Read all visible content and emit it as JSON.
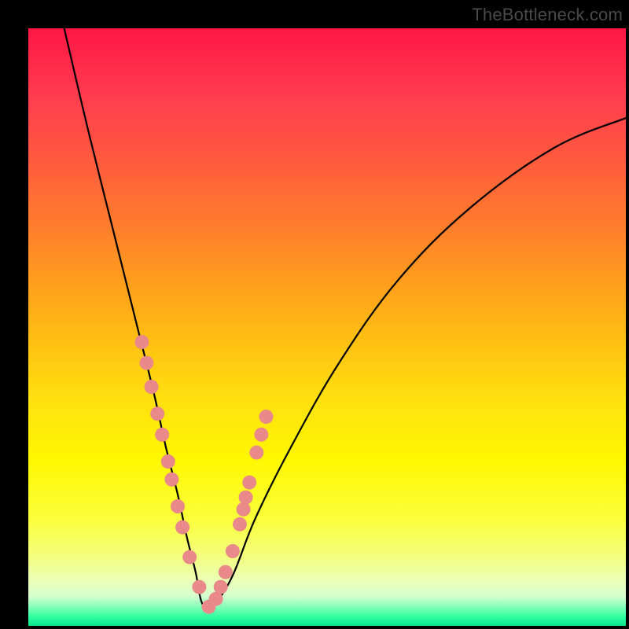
{
  "watermark": "TheBottleneck.com",
  "colors": {
    "dot": "#e98989",
    "curve": "#000000",
    "frame": "#000000"
  },
  "chart_data": {
    "type": "line",
    "title": "",
    "xlabel": "",
    "ylabel": "",
    "x_range": [
      0,
      100
    ],
    "y_range": [
      0,
      100
    ],
    "note": "Scales approximate; no axis labels visible in image.",
    "series": [
      {
        "name": "bottleneck-curve",
        "x": [
          6,
          10,
          14,
          18,
          21,
          23,
          25,
          26.5,
          28,
          29,
          30.5,
          34,
          38,
          44,
          52,
          62,
          74,
          88,
          100
        ],
        "y": [
          100,
          83,
          67,
          51,
          39,
          30,
          22,
          15,
          9,
          4,
          3,
          8,
          18,
          30,
          44,
          58,
          70,
          80,
          85
        ]
      }
    ],
    "markers": {
      "name": "highlighted-points",
      "x": [
        19.0,
        19.8,
        20.6,
        21.6,
        22.4,
        23.4,
        24.0,
        25.0,
        25.8,
        27.0,
        28.6,
        30.2,
        31.4,
        32.2,
        33.0,
        34.2,
        35.4,
        36.0,
        36.4,
        37.0,
        38.2,
        39.0,
        39.8
      ],
      "y": [
        47.5,
        44.0,
        40.0,
        35.5,
        32.0,
        27.5,
        24.5,
        20.0,
        16.5,
        11.5,
        6.5,
        3.2,
        4.5,
        6.5,
        9.0,
        12.5,
        17.0,
        19.5,
        21.5,
        24.0,
        29.0,
        32.0,
        35.0
      ]
    }
  }
}
